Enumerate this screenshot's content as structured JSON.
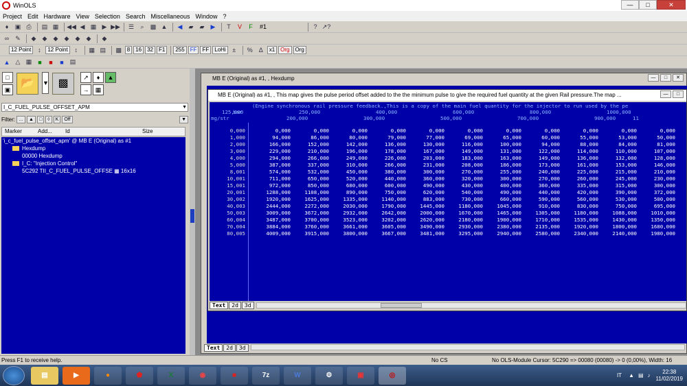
{
  "app": {
    "title": "WinOLS"
  },
  "menu": [
    "Project",
    "Edit",
    "Hardware",
    "View",
    "Selection",
    "Search",
    "Miscellaneous",
    "Window",
    "?"
  ],
  "toolbar": {
    "version_label": "#1",
    "font_size_a": "12 Point",
    "font_size_b": "12 Point",
    "bits_8": "8",
    "bits_16": "16",
    "bits_32": "32",
    "bits_f1": "F1",
    "radix_255": "255",
    "radix_ff": "FF",
    "radix_ff2": "FF",
    "lohi": "LoHi",
    "x1": "x1",
    "org": "Org",
    "org2": "Org"
  },
  "left": {
    "map_selector": "I_C_FUEL_PULSE_OFFSET_APM",
    "filter_label": "Filter:",
    "filter_off": "Off",
    "columns": [
      "Marker",
      "Add...",
      "Id",
      "Size"
    ],
    "tree": [
      {
        "text": "'i_c_fuel_pulse_offset_apm' @ MB E (Original) as #1",
        "indent": 0,
        "folder": false
      },
      {
        "text": "Hexdump",
        "indent": 1,
        "folder": true
      },
      {
        "text": "00000        Hexdump",
        "indent": 2,
        "folder": false
      },
      {
        "text": "I_C: \"Injection Control\"",
        "indent": 1,
        "folder": true
      },
      {
        "text": "5C292        TII_C_FUEL_PULSE_OFFSE ▦ 16x16",
        "indent": 2,
        "folder": false
      }
    ]
  },
  "win1": {
    "title": "MB E (Original) as #1, , Hexdump",
    "tabs": [
      "Text",
      "2d",
      "3d"
    ]
  },
  "win2": {
    "title": "MB E (Original) as #1, , This map gives the pulse period offset added to the the minimum pulse to give the required fuel quantity at the given Rail pressure.The map ...",
    "desc": "(Engine synchronous rail pressure feedback.,This is a copy of the main fuel quantity for the injector to run used by the pe",
    "bar_label": "bar",
    "unit_label": "mg/str",
    "col_top": [
      "125,000",
      "250,000",
      "400,000",
      "600,000",
      "800,000",
      "1000,000"
    ],
    "col_bottom": [
      "200,000",
      "300,000",
      "500,000",
      "700,000",
      "900,000",
      "11"
    ],
    "rows": [
      {
        "label": "0,000",
        "v": [
          "0,000",
          "0,000",
          "0,000",
          "0,000",
          "0,000",
          "0,000",
          "0,000",
          "0,000",
          "0,000",
          "0,000",
          "0,000"
        ]
      },
      {
        "label": "1,000",
        "v": [
          "94,000",
          "86,000",
          "80,000",
          "79,000",
          "77,000",
          "69,000",
          "65,000",
          "60,000",
          "55,000",
          "53,000",
          "50,000"
        ]
      },
      {
        "label": "2,000",
        "v": [
          "166,000",
          "152,000",
          "142,000",
          "136,000",
          "130,000",
          "116,000",
          "100,000",
          "94,000",
          "88,000",
          "84,000",
          "81,000"
        ]
      },
      {
        "label": "3,000",
        "v": [
          "229,000",
          "210,000",
          "196,000",
          "178,000",
          "167,000",
          "149,000",
          "131,000",
          "122,000",
          "114,000",
          "110,000",
          "107,000"
        ]
      },
      {
        "label": "4,000",
        "v": [
          "294,000",
          "266,000",
          "249,000",
          "226,000",
          "203,000",
          "183,000",
          "163,000",
          "149,000",
          "136,000",
          "132,000",
          "128,000"
        ]
      },
      {
        "label": "5,000",
        "v": [
          "387,000",
          "337,000",
          "310,000",
          "266,000",
          "231,000",
          "208,000",
          "186,000",
          "173,000",
          "161,000",
          "153,000",
          "146,000"
        ]
      },
      {
        "label": "8,001",
        "v": [
          "574,000",
          "532,000",
          "450,000",
          "380,000",
          "300,000",
          "270,000",
          "255,000",
          "240,000",
          "225,000",
          "215,000",
          "210,000"
        ]
      },
      {
        "label": "10,001",
        "v": [
          "711,000",
          "650,000",
          "520,000",
          "440,000",
          "360,000",
          "320,000",
          "300,000",
          "270,000",
          "260,000",
          "245,000",
          "230,000"
        ]
      },
      {
        "label": "15,001",
        "v": [
          "972,000",
          "850,000",
          "680,000",
          "600,000",
          "490,000",
          "430,000",
          "400,000",
          "360,000",
          "335,000",
          "315,000",
          "300,000"
        ]
      },
      {
        "label": "20,001",
        "v": [
          "1288,000",
          "1108,000",
          "890,000",
          "750,000",
          "620,000",
          "540,000",
          "490,000",
          "440,000",
          "420,000",
          "390,000",
          "372,000"
        ]
      },
      {
        "label": "30,002",
        "v": [
          "1920,000",
          "1625,000",
          "1335,000",
          "1140,000",
          "883,000",
          "730,000",
          "660,000",
          "590,000",
          "560,000",
          "530,000",
          "500,000"
        ]
      },
      {
        "label": "40,003",
        "v": [
          "2444,000",
          "2272,000",
          "2030,000",
          "1790,000",
          "1445,000",
          "1180,000",
          "1045,000",
          "910,000",
          "830,000",
          "750,000",
          "695,000"
        ]
      },
      {
        "label": "50,003",
        "v": [
          "3009,000",
          "3672,000",
          "2932,000",
          "2642,000",
          "2000,000",
          "1670,000",
          "1465,000",
          "1305,000",
          "1180,000",
          "1088,000",
          "1010,000"
        ]
      },
      {
        "label": "60,004",
        "v": [
          "3487,000",
          "3700,000",
          "3523,000",
          "3202,000",
          "2620,000",
          "2180,000",
          "1900,000",
          "1710,000",
          "1535,000",
          "1430,000",
          "1350,000"
        ]
      },
      {
        "label": "70,004",
        "v": [
          "3884,000",
          "3760,000",
          "3661,000",
          "3605,000",
          "3490,000",
          "2930,000",
          "2380,000",
          "2135,000",
          "1920,000",
          "1800,000",
          "1680,000"
        ]
      },
      {
        "label": "80,005",
        "v": [
          "4009,000",
          "3915,000",
          "3800,000",
          "3667,000",
          "3481,000",
          "3295,000",
          "2940,000",
          "2580,000",
          "2340,000",
          "2140,000",
          "1980,000"
        ]
      }
    ],
    "tabs": [
      "Text",
      "2d",
      "3d"
    ]
  },
  "status": {
    "help": "Press F1 to receive help.",
    "cs": "No CS",
    "module": "No OLS-Module  Cursor: 5C290 => 00080 (00080) -> 0 (0,00%), Width: 16"
  },
  "taskbar": {
    "lang": "IT",
    "time": "22:38",
    "date": "11/02/2019",
    "apps": [
      "explorer",
      "media",
      "firefox",
      "app-red",
      "excel",
      "chrome",
      "winols-tool",
      "7z",
      "word",
      "tool",
      "app-red2",
      "winols"
    ]
  }
}
